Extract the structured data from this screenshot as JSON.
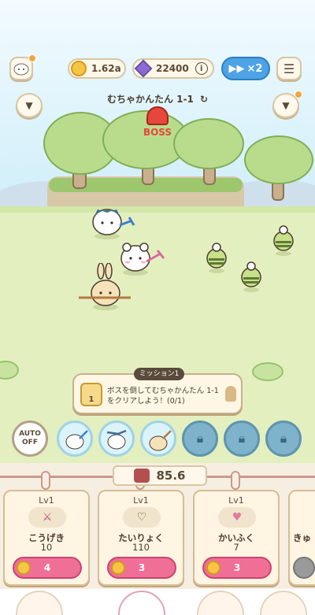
{
  "header": {
    "gold": "1.62a",
    "gems": "22400",
    "speed_label": "×2",
    "stage": "むちゃかんたん 1-1",
    "boss_label": "BOSS"
  },
  "mission": {
    "tag": "ミッション1",
    "level": "1",
    "text": "ボスを倒してむちゃかんたん 1-1をクリアしよう！(0/1)"
  },
  "skills": {
    "auto_line1": "AUTO",
    "auto_line2": "OFF"
  },
  "power": "85.6",
  "cards": [
    {
      "lv": "Lv1",
      "name": "こうげき",
      "value": "10",
      "cost": "4"
    },
    {
      "lv": "Lv1",
      "name": "たいりょく",
      "value": "110",
      "cost": "3"
    },
    {
      "lv": "Lv1",
      "name": "かいふく",
      "value": "7",
      "cost": "3"
    },
    {
      "lv": "",
      "name": "きゅ",
      "value": "",
      "cost": ""
    }
  ],
  "colors": {
    "accent": "#ef6f97",
    "speed": "#4da3e6",
    "boss": "#e6463c",
    "field": "#e4efc0"
  },
  "icons": [
    "avatar-icon",
    "coin-icon",
    "gem-icon",
    "info-icon",
    "fast-forward-icon",
    "menu-icon",
    "chevron-down-icon",
    "refresh-icon",
    "lock-icon",
    "bell-icon"
  ]
}
